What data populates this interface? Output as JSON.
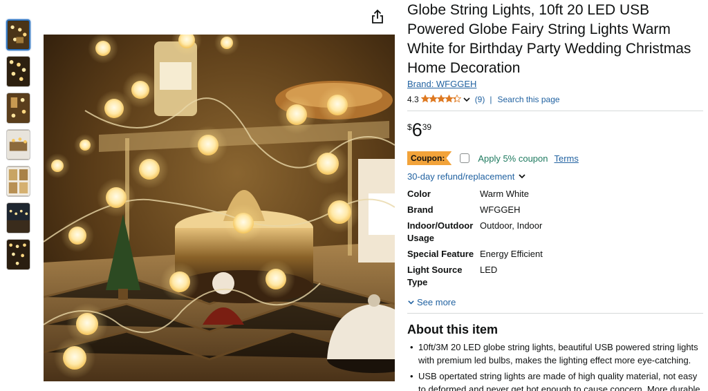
{
  "product": {
    "title": "Globe String Lights, 10ft 20 LED USB Powered Globe Fairy String Lights Warm White for Birthday Party Wedding Christmas Home Decoration",
    "brand_link": "Brand: WFGGEH",
    "rating": "4.3",
    "stars_value": 4.3,
    "reviews": "(9)",
    "separator": "|",
    "search_page": "Search this page"
  },
  "price": {
    "symbol": "$",
    "whole": "6",
    "fraction": "39"
  },
  "coupon": {
    "badge": "Coupon:",
    "text": "Apply 5% coupon",
    "terms": "Terms"
  },
  "refund": "30-day refund/replacement",
  "specs": [
    {
      "key": "Color",
      "value": "Warm White"
    },
    {
      "key": "Brand",
      "value": "WFGGEH"
    },
    {
      "key": "Indoor/Outdoor Usage",
      "value": "Outdoor, Indoor"
    },
    {
      "key": "Special Feature",
      "value": "Energy Efficient"
    },
    {
      "key": "Light Source Type",
      "value": "LED"
    }
  ],
  "see_more": "See more",
  "about": {
    "title": "About this item",
    "bullets": [
      "10ft/3M 20 LED globe string lights, beautiful USB powered string lights with premium led bulbs, makes the lighting effect more eye-catching.",
      "USB opertated string lights are made of high quality material, not easy to deformed and never get hot enough to cause concern. More durable,"
    ]
  },
  "colors": {
    "link": "#2162a1",
    "star": "#de7921",
    "coupon_badge": "#f2a33a",
    "coupon_text": "#1e7a5f",
    "selected_thumb_border": "#2f74c0"
  },
  "icons": {
    "share": "share-icon",
    "chevron": "chevron-down-icon",
    "star": "star-icon",
    "checkbox": "checkbox-icon"
  }
}
